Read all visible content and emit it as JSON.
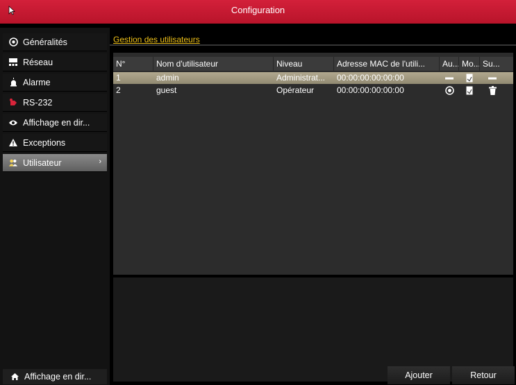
{
  "window": {
    "title": "Configuration"
  },
  "sidebar": {
    "items": [
      {
        "label": "Généralités",
        "icon": "settings-icon"
      },
      {
        "label": "Réseau",
        "icon": "network-icon"
      },
      {
        "label": "Alarme",
        "icon": "alarm-icon"
      },
      {
        "label": "RS-232",
        "icon": "rs232-icon"
      },
      {
        "label": "Affichage en dir...",
        "icon": "eye-icon"
      },
      {
        "label": "Exceptions",
        "icon": "warning-icon"
      },
      {
        "label": "Utilisateur",
        "icon": "users-icon",
        "active": true
      }
    ],
    "live_view_label": "Affichage en dir..."
  },
  "main": {
    "tab_label": "Gestion des utilisateurs",
    "columns": [
      "N°",
      "Nom d'utilisateur",
      "Niveau",
      "Adresse MAC de l'utili...",
      "Au...",
      "Mo...",
      "Su..."
    ],
    "rows": [
      {
        "no": "1",
        "name": "admin",
        "level": "Administrat...",
        "mac": "00:00:00:00:00:00",
        "auth": "dash-icon",
        "modify": "edit-icon",
        "delete": "dash-icon",
        "selected": true
      },
      {
        "no": "2",
        "name": "guest",
        "level": "Opérateur",
        "mac": "00:00:00:00:00:00",
        "auth": "permission-icon",
        "modify": "edit-icon",
        "delete": "trash-icon",
        "selected": false
      }
    ]
  },
  "buttons": {
    "add": "Ajouter",
    "back": "Retour"
  },
  "colors": {
    "titlebar": "#c8192f",
    "tab_label": "#f0c219",
    "selected_row": "#a39b80"
  }
}
